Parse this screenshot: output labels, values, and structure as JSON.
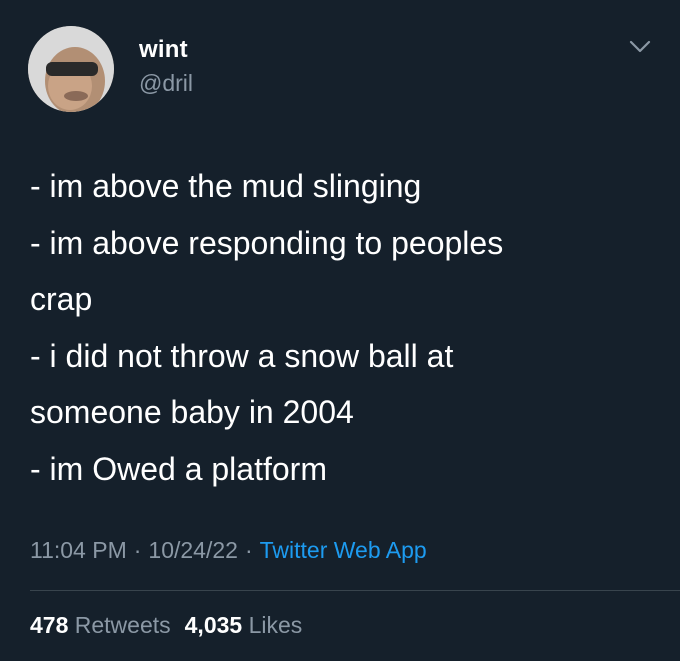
{
  "tweet": {
    "author": {
      "display_name": "wint",
      "handle": "@dril"
    },
    "more_icon": "chevron-down-icon",
    "lines": [
      "- im above the mud slinging",
      "- im above responding to peoples",
      "crap",
      "- i did not throw a snow ball at",
      "someone baby in 2004",
      "- im Owed a platform"
    ],
    "time": "11:04 PM",
    "date": "10/24/22",
    "separator": "·",
    "source": "Twitter Web App",
    "retweets_count": "478",
    "retweets_label": "Retweets",
    "likes_count": "4,035",
    "likes_label": "Likes"
  },
  "colors": {
    "background": "#15202b",
    "primary_text": "#ffffff",
    "secondary_text": "#8b98a5",
    "link": "#1d9bf0",
    "divider": "#38444d"
  }
}
